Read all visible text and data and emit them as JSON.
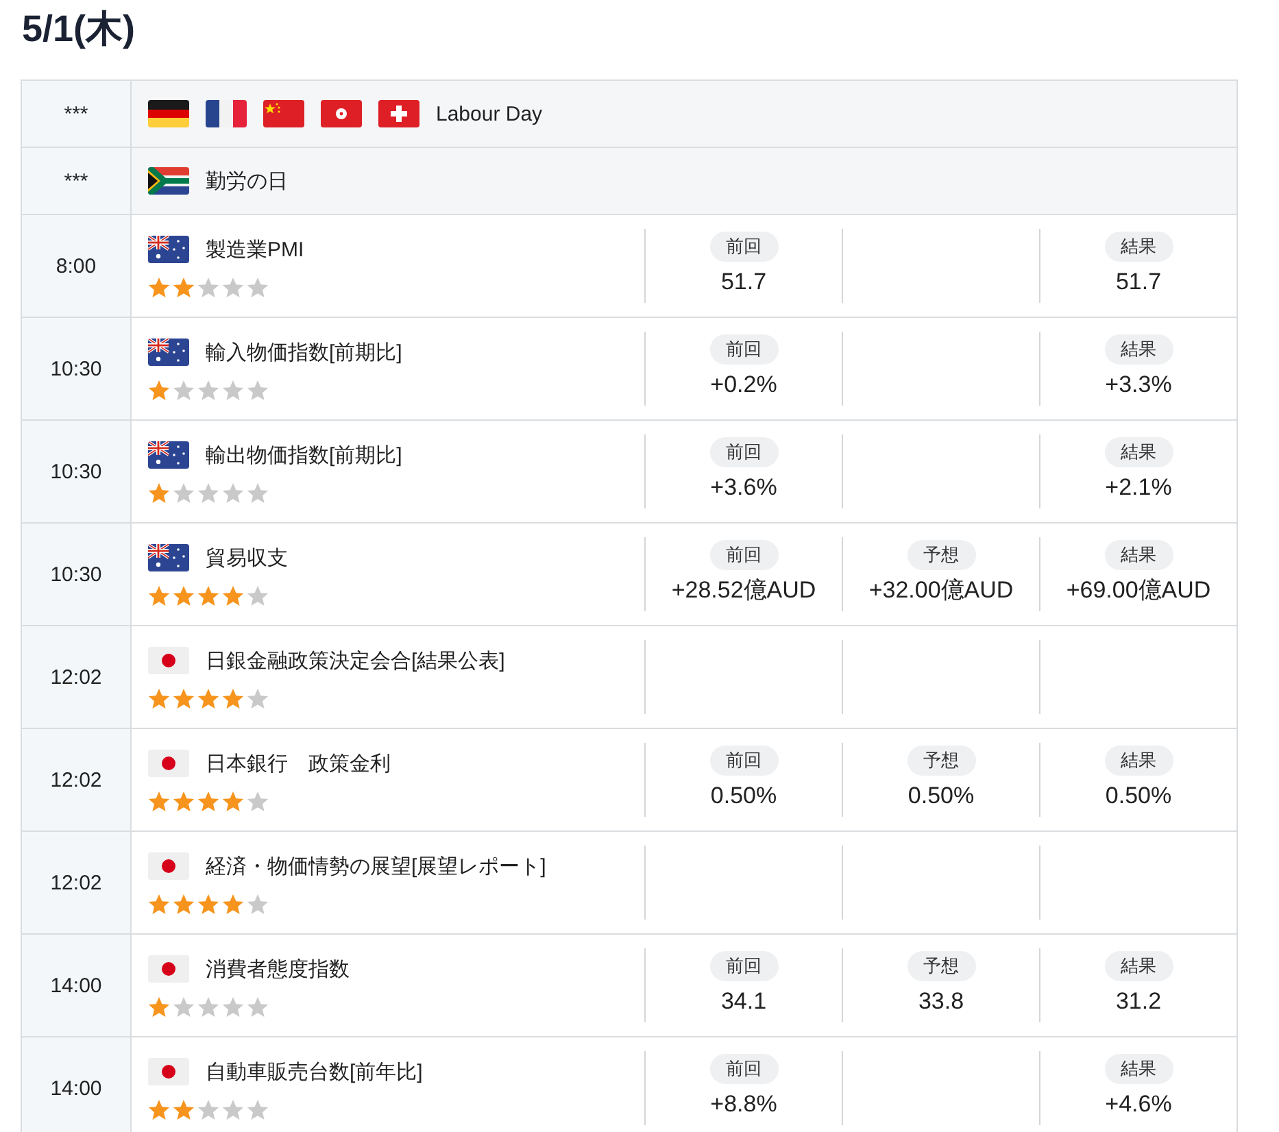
{
  "date": "5/1(木)",
  "rows": [
    {
      "kind": "holiday",
      "time": "***",
      "flags": [
        {
          "kind": "de"
        },
        {
          "kind": "fr"
        },
        {
          "kind": "cn"
        },
        {
          "kind": "hk"
        },
        {
          "kind": "ch"
        }
      ],
      "name": "Labour Day"
    },
    {
      "kind": "holiday",
      "time": "***",
      "flags": [
        {
          "kind": "za"
        }
      ],
      "name": "勤労の日"
    },
    {
      "kind": "event",
      "time": "8:00",
      "flags": [
        {
          "kind": "au"
        }
      ],
      "name": "製造業PMI",
      "stars": 2,
      "previous": {
        "label": "前回",
        "value": "51.7"
      },
      "result": {
        "label": "結果",
        "value": "51.7"
      }
    },
    {
      "kind": "event",
      "time": "10:30",
      "flags": [
        {
          "kind": "au"
        }
      ],
      "name": "輸入物価指数[前期比]",
      "stars": 1,
      "previous": {
        "label": "前回",
        "value": "+0.2%"
      },
      "result": {
        "label": "結果",
        "value": "+3.3%"
      }
    },
    {
      "kind": "event",
      "time": "10:30",
      "flags": [
        {
          "kind": "au"
        }
      ],
      "name": "輸出物価指数[前期比]",
      "stars": 1,
      "previous": {
        "label": "前回",
        "value": "+3.6%"
      },
      "result": {
        "label": "結果",
        "value": "+2.1%"
      }
    },
    {
      "kind": "event",
      "time": "10:30",
      "flags": [
        {
          "kind": "au"
        }
      ],
      "name": "貿易収支",
      "stars": 4,
      "previous": {
        "label": "前回",
        "value": "+28.52億AUD"
      },
      "forecast": {
        "label": "予想",
        "value": "+32.00億AUD"
      },
      "result": {
        "label": "結果",
        "value": "+69.00億AUD"
      }
    },
    {
      "kind": "event",
      "time": "12:02",
      "flags": [
        {
          "kind": "jp"
        }
      ],
      "name": "日銀金融政策決定会合[結果公表]",
      "stars": 4
    },
    {
      "kind": "event",
      "time": "12:02",
      "flags": [
        {
          "kind": "jp"
        }
      ],
      "name": "日本銀行　政策金利",
      "stars": 4,
      "previous": {
        "label": "前回",
        "value": "0.50%"
      },
      "forecast": {
        "label": "予想",
        "value": "0.50%"
      },
      "result": {
        "label": "結果",
        "value": "0.50%"
      }
    },
    {
      "kind": "event",
      "time": "12:02",
      "flags": [
        {
          "kind": "jp"
        }
      ],
      "name": "経済・物価情勢の展望[展望レポート]",
      "stars": 4
    },
    {
      "kind": "event",
      "time": "14:00",
      "flags": [
        {
          "kind": "jp"
        }
      ],
      "name": "消費者態度指数",
      "stars": 1,
      "previous": {
        "label": "前回",
        "value": "34.1"
      },
      "forecast": {
        "label": "予想",
        "value": "33.8"
      },
      "result": {
        "label": "結果",
        "value": "31.2"
      }
    },
    {
      "kind": "event",
      "time": "14:00",
      "flags": [
        {
          "kind": "jp"
        }
      ],
      "name": "自動車販売台数[前年比]",
      "stars": 2,
      "previous": {
        "label": "前回",
        "value": "+8.8%"
      },
      "result": {
        "label": "結果",
        "value": "+4.6%"
      }
    }
  ]
}
